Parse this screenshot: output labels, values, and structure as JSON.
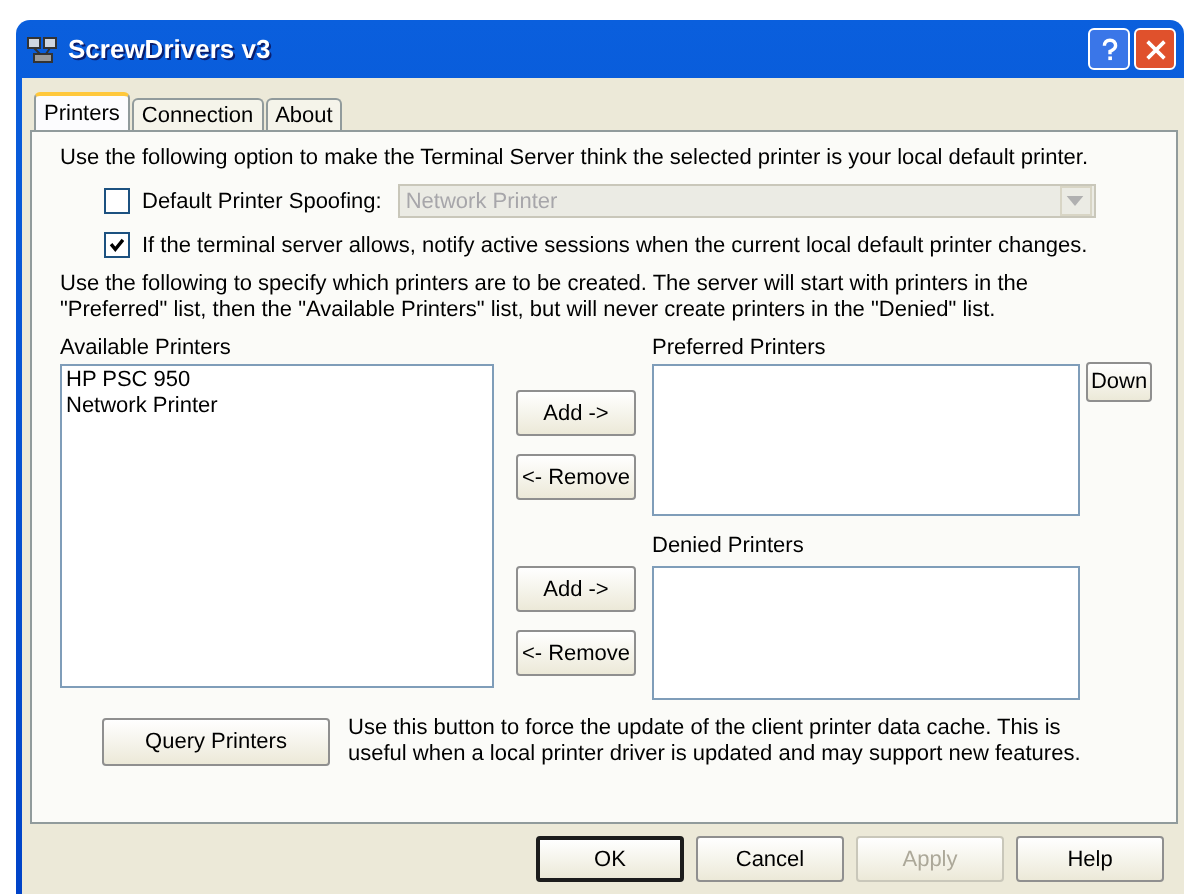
{
  "window": {
    "title": "ScrewDrivers v3"
  },
  "tabs": [
    {
      "label": "Printers",
      "selected": true
    },
    {
      "label": "Connection",
      "selected": false
    },
    {
      "label": "About",
      "selected": false
    }
  ],
  "spoofing_intro": "Use the following option to make the Terminal Server think the selected printer is your local default printer.",
  "spoofing": {
    "label": "Default Printer Spoofing:",
    "checked": false,
    "dropdown_value": "Network Printer",
    "dropdown_disabled": true
  },
  "notify": {
    "label": "If the terminal server allows, notify active sessions when the current local default printer changes.",
    "checked": true
  },
  "lists_intro": "Use the following to specify which printers are to be created.  The server will start with printers in the \"Preferred\" list, then the \"Available Printers\" list, but will never create printers in the \"Denied\" list.",
  "available": {
    "label": "Available Printers",
    "items": [
      "HP PSC 950",
      "Network Printer"
    ]
  },
  "preferred": {
    "label": "Preferred Printers",
    "add": "Add ->",
    "remove": "<- Remove",
    "down": "Down"
  },
  "denied": {
    "label": "Denied Printers",
    "add": "Add ->",
    "remove": "<- Remove"
  },
  "query": {
    "button": "Query Printers",
    "description": "Use this button to force the update of the client printer data cache.  This is useful when a local printer driver is updated and may support new features."
  },
  "buttons": [
    {
      "label": "OK",
      "default": true,
      "disabled": false
    },
    {
      "label": "Cancel",
      "default": false,
      "disabled": false
    },
    {
      "label": "Apply",
      "default": false,
      "disabled": true
    },
    {
      "label": "Help",
      "default": false,
      "disabled": false
    }
  ]
}
